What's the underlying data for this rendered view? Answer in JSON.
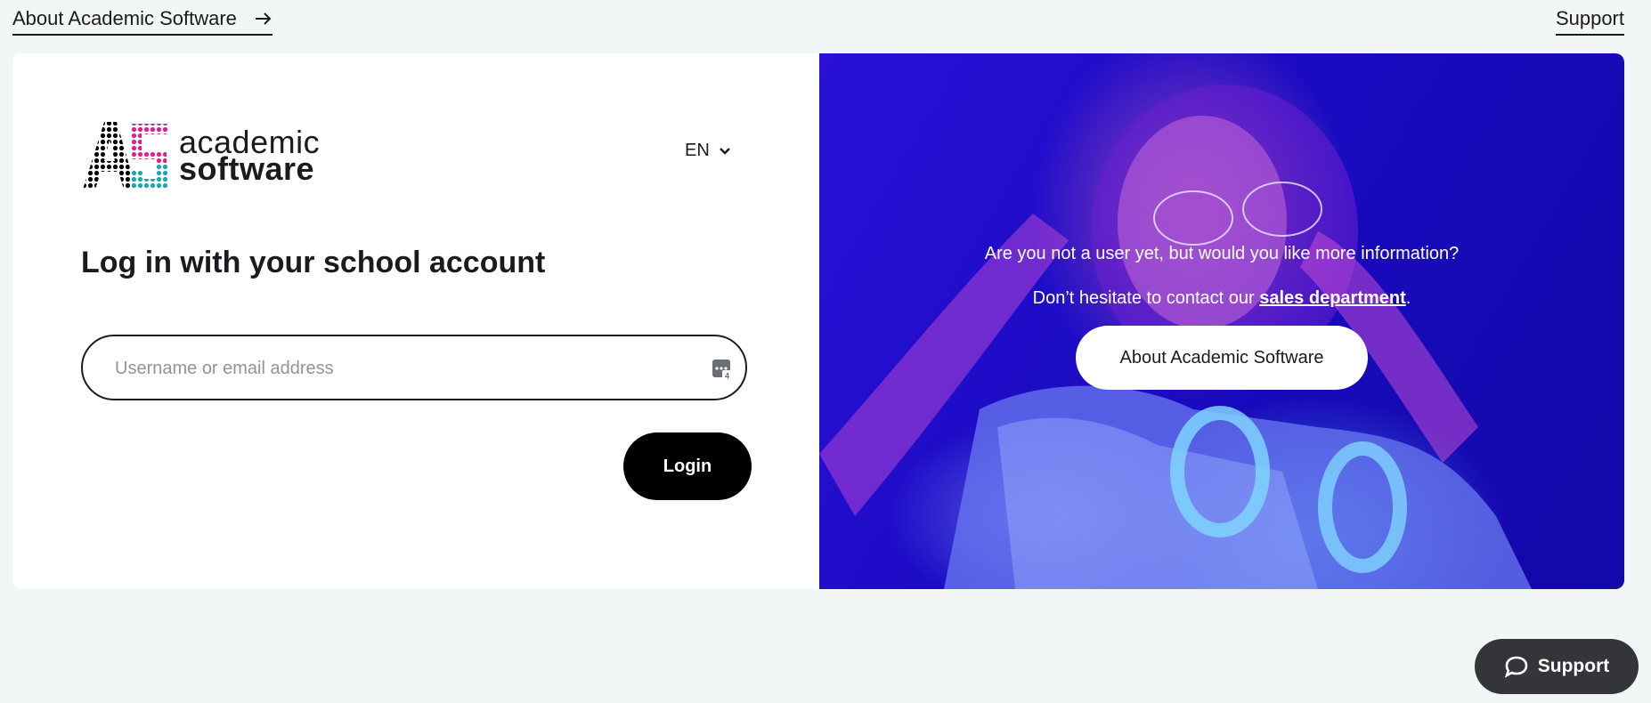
{
  "top": {
    "about_link": "About Academic Software",
    "support_link": "Support"
  },
  "logo": {
    "line1": "academic",
    "line2": "software"
  },
  "language": {
    "selected": "EN"
  },
  "login": {
    "heading": "Log in with your school account",
    "username_placeholder": "Username or email address",
    "username_value": "",
    "button": "Login"
  },
  "promo": {
    "line1": "Are you not a user yet, but would you like more information?",
    "line2_prefix": "Don’t hesitate to contact our ",
    "line2_link": "sales department",
    "line2_suffix": ".",
    "button": "About Academic Software"
  },
  "support_fab": {
    "label": "Support"
  },
  "icons": {
    "arrow": "arrow-right-icon",
    "chevron": "chevron-down-icon",
    "password_manager": "password-manager-icon",
    "chat": "chat-bubble-icon"
  },
  "colors": {
    "background": "#f3f6f6",
    "accent": "#000000",
    "promo_blue": "#1a0bc2"
  }
}
